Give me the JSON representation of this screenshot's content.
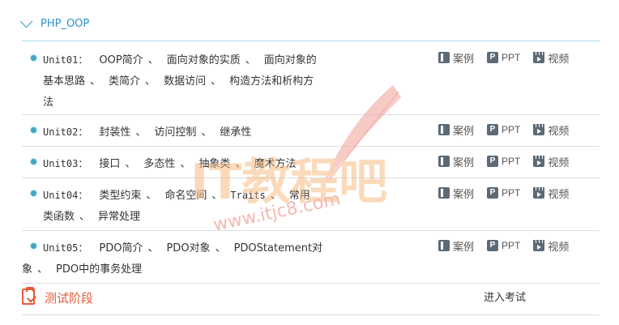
{
  "section": {
    "title": "PHP_OOP"
  },
  "units": [
    {
      "label": "Unit01：",
      "topics": [
        "OOP简介",
        "面向对象的实质",
        "面向对象的基本思路",
        "类简介",
        "数据访问",
        "构造方法和析构方法"
      ]
    },
    {
      "label": "Unit02：",
      "topics": [
        "封装性",
        "访问控制",
        "继承性"
      ]
    },
    {
      "label": "Unit03：",
      "topics": [
        "接口",
        "多态性",
        "抽象类",
        "魔术方法"
      ]
    },
    {
      "label": "Unit04：",
      "topics": [
        "类型约束",
        "命名空间",
        "Traits",
        "常用类函数",
        "异常处理"
      ]
    },
    {
      "label": "Unit05：",
      "topics": [
        "PDO简介",
        "PDO对象",
        "PDOStatement对象",
        "PDO中的事务处理"
      ]
    }
  ],
  "separator": "、",
  "actions": {
    "case_label": "案例",
    "ppt_label": "PPT",
    "ppt_icon": "P",
    "video_label": "视频"
  },
  "exam": {
    "title": "测试阶段",
    "enter_label": "进入考试"
  },
  "watermark": {
    "brand": "IT教程吧",
    "url": "www.itjc8.com"
  },
  "colors": {
    "accent": "#2a93c9",
    "exam": "#e85a37",
    "icon": "#5d6a76",
    "watermark": "#f08a82"
  }
}
